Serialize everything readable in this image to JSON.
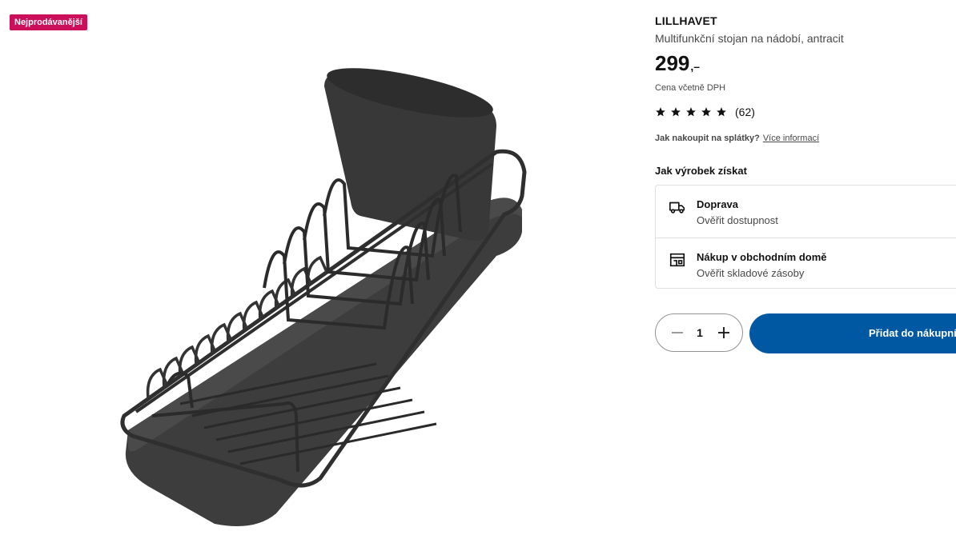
{
  "badge": "Nejprodávanější",
  "product": {
    "name": "LILLHAVET",
    "description": "Multifunkční stojan na nádobí, antracit",
    "price_integer": "299",
    "price_suffix": ",–",
    "vat_note": "Cena včetně DPH",
    "rating": {
      "stars": 5,
      "count_text": "(62)"
    },
    "installment": {
      "question": "Jak nakoupit na splátky?",
      "link": "Více informací"
    }
  },
  "availability": {
    "title": "Jak výrobek získat",
    "options": [
      {
        "icon": "truck-icon",
        "title": "Doprava",
        "subtitle": "Ověřit dostupnost"
      },
      {
        "icon": "store-icon",
        "title": "Nákup v obchodním domě",
        "subtitle": "Ověřit skladové zásoby"
      }
    ]
  },
  "cart": {
    "quantity": "1",
    "add_label": "Přidat do nákupní"
  },
  "colors": {
    "badge": "#cc0f5a",
    "primary": "#0058a3",
    "product": "#3b3b3b"
  }
}
